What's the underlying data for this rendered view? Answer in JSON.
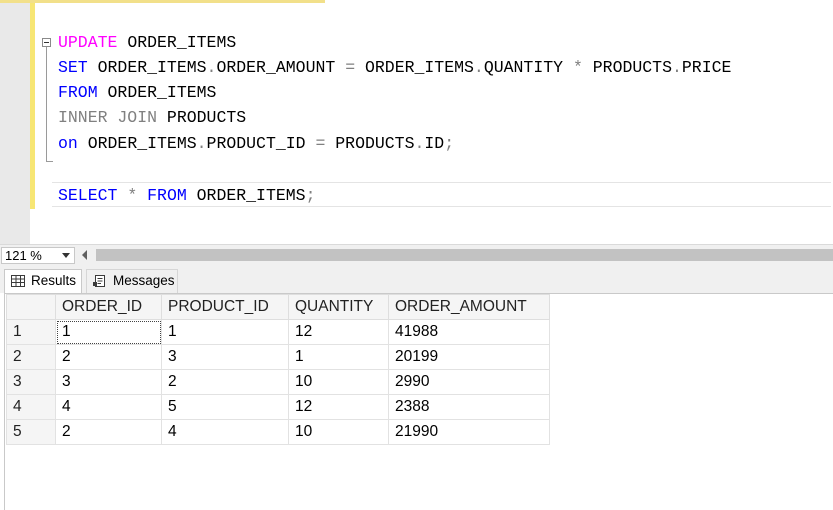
{
  "editor": {
    "lines": [
      [
        {
          "t": "UPDATE",
          "c": "kw-magenta"
        },
        {
          "t": " ORDER_ITEMS",
          "c": ""
        }
      ],
      [
        {
          "t": "SET",
          "c": "kw-blue"
        },
        {
          "t": " ORDER_ITEMS",
          "c": ""
        },
        {
          "t": ".",
          "c": "kw-gray"
        },
        {
          "t": "ORDER_AMOUNT ",
          "c": ""
        },
        {
          "t": "=",
          "c": "kw-gray"
        },
        {
          "t": " ORDER_ITEMS",
          "c": ""
        },
        {
          "t": ".",
          "c": "kw-gray"
        },
        {
          "t": "QUANTITY ",
          "c": ""
        },
        {
          "t": "*",
          "c": "kw-gray"
        },
        {
          "t": " PRODUCTS",
          "c": ""
        },
        {
          "t": ".",
          "c": "kw-gray"
        },
        {
          "t": "PRICE",
          "c": ""
        }
      ],
      [
        {
          "t": "FROM",
          "c": "kw-blue"
        },
        {
          "t": " ORDER_ITEMS",
          "c": ""
        }
      ],
      [
        {
          "t": "INNER JOIN",
          "c": "kw-gray"
        },
        {
          "t": " PRODUCTS",
          "c": ""
        }
      ],
      [
        {
          "t": "on",
          "c": "kw-blue"
        },
        {
          "t": " ORDER_ITEMS",
          "c": ""
        },
        {
          "t": ".",
          "c": "kw-gray"
        },
        {
          "t": "PRODUCT_ID ",
          "c": ""
        },
        {
          "t": "=",
          "c": "kw-gray"
        },
        {
          "t": " PRODUCTS",
          "c": ""
        },
        {
          "t": ".",
          "c": "kw-gray"
        },
        {
          "t": "ID",
          "c": ""
        },
        {
          "t": ";",
          "c": "kw-gray"
        }
      ],
      [],
      [
        {
          "t": "SELECT",
          "c": "kw-blue"
        },
        {
          "t": " ",
          "c": ""
        },
        {
          "t": "*",
          "c": "kw-gray"
        },
        {
          "t": " ",
          "c": ""
        },
        {
          "t": "FROM",
          "c": "kw-blue"
        },
        {
          "t": " ORDER_ITEMS",
          "c": ""
        },
        {
          "t": ";",
          "c": "kw-gray"
        }
      ]
    ]
  },
  "status": {
    "zoom": "121 %"
  },
  "tabs": {
    "results_label": "Results",
    "messages_label": "Messages"
  },
  "grid": {
    "columns": [
      "ORDER_ID",
      "PRODUCT_ID",
      "QUANTITY",
      "ORDER_AMOUNT"
    ],
    "rows": [
      {
        "num": "1",
        "cells": [
          "1",
          "1",
          "12",
          "41988"
        ]
      },
      {
        "num": "2",
        "cells": [
          "2",
          "3",
          "1",
          "20199"
        ]
      },
      {
        "num": "3",
        "cells": [
          "3",
          "2",
          "10",
          "2990"
        ]
      },
      {
        "num": "4",
        "cells": [
          "4",
          "5",
          "12",
          "2388"
        ]
      },
      {
        "num": "5",
        "cells": [
          "2",
          "4",
          "10",
          "21990"
        ]
      }
    ]
  },
  "colors": {
    "keyword_blue": "#0000ff",
    "keyword_magenta": "#ff00ff",
    "operator_gray": "#808080",
    "change_bar": "#f7e674"
  }
}
